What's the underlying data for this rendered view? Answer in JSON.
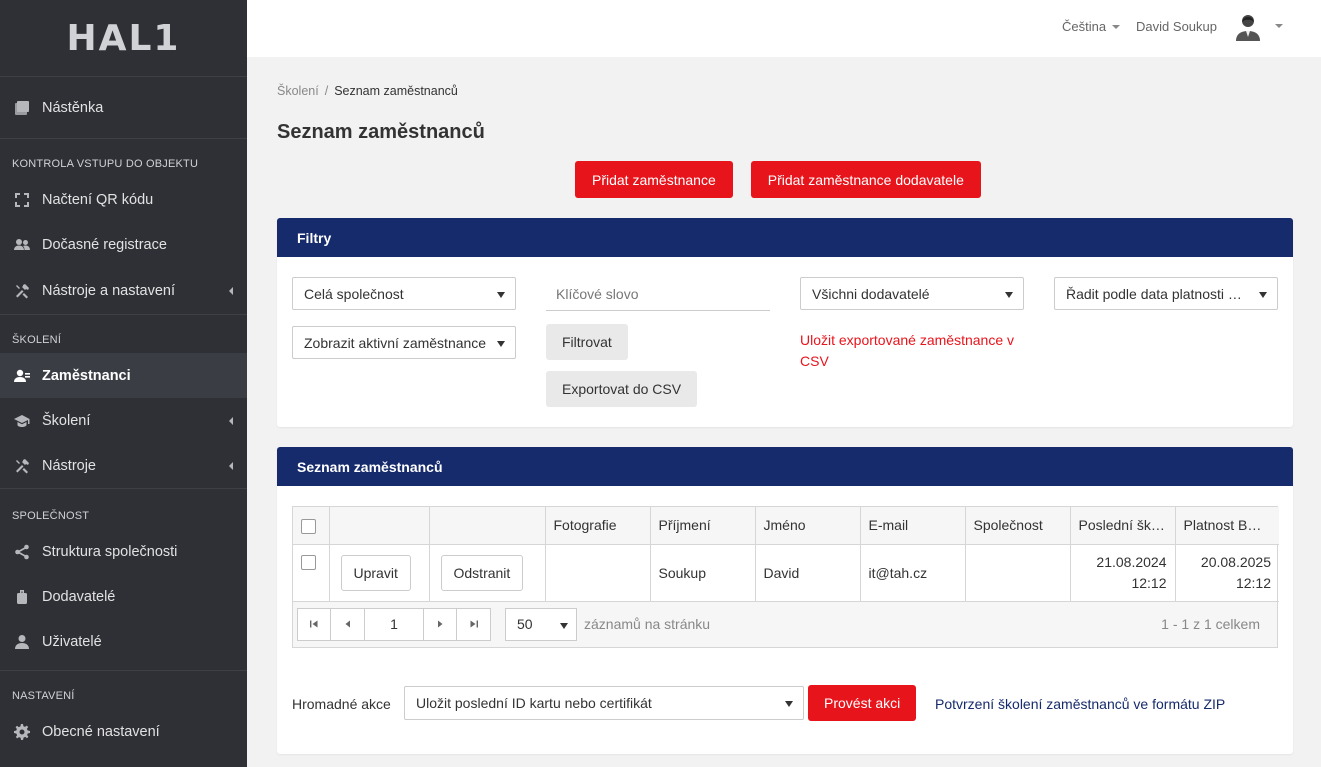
{
  "sidebar": {
    "logo": "HAL1",
    "items": [
      {
        "label": "Nástěnka"
      },
      {
        "section": "Kontrola vstupu do objektu"
      },
      {
        "label": "Načtení QR kódu"
      },
      {
        "label": "Dočasné registrace"
      },
      {
        "label": "Nástroje a nastavení"
      },
      {
        "section": "Školení"
      },
      {
        "label": "Zaměstnanci"
      },
      {
        "label": "Školení"
      },
      {
        "label": "Nástroje"
      },
      {
        "section": "Společnost"
      },
      {
        "label": "Struktura společnosti"
      },
      {
        "label": "Dodavatelé"
      },
      {
        "label": "Uživatelé"
      },
      {
        "section": "Nastavení"
      },
      {
        "label": "Obecné nastavení"
      }
    ]
  },
  "topbar": {
    "language": "Čeština",
    "user_name": "David Soukup"
  },
  "breadcrumb": {
    "parent": "Školení",
    "separator": "/",
    "current": "Seznam zaměstnanců"
  },
  "page": {
    "title": "Seznam zaměstnanců",
    "add_employee_label": "Přidat zaměstnance",
    "add_supplier_employee_label": "Přidat zaměstnance dodavatele"
  },
  "filters": {
    "title": "Filtry",
    "company_select": "Celá společnost",
    "keyword_placeholder": "Klíčové slovo",
    "supplier_select": "Všichni dodavatelé",
    "sort_select": "Řadit podle data platnosti BOZP",
    "status_select": "Zobrazit aktivní zaměstnance",
    "filter_button": "Filtrovat",
    "export_button": "Exportovat do CSV",
    "export_note": "Uložit exportované zaměstnance v CSV"
  },
  "employees": {
    "title": "Seznam zaměstnanců",
    "columns": [
      "",
      "",
      "",
      "Fotografie",
      "Příjmení",
      "Jméno",
      "E-mail",
      "Společnost",
      "Poslední školení",
      "Platnost BOZP"
    ],
    "rows": [
      {
        "edit_label": "Upravit",
        "delete_label": "Odstranit",
        "photo": "",
        "surname": "Soukup",
        "name": "David",
        "email": "it@tah.cz",
        "company": "",
        "last_training_date": "21.08.2024",
        "last_training_time": "12:12",
        "validity_date": "20.08.2025",
        "validity_time": "12:12"
      }
    ],
    "pager": {
      "page": "1",
      "page_size": "50",
      "page_size_label": "záznamů na stránku",
      "info": "1 - 1 z 1 celkem"
    },
    "bulk": {
      "label": "Hromadné akce",
      "select": "Uložit poslední ID kartu nebo certifikát",
      "run_button": "Provést akci",
      "zip_link": "Potvrzení školení zaměstnanců ve formátu ZIP"
    }
  },
  "colors": {
    "accent_red": "#e8141c",
    "header_navy": "#162b6b",
    "sidebar_bg": "#2e3036"
  }
}
